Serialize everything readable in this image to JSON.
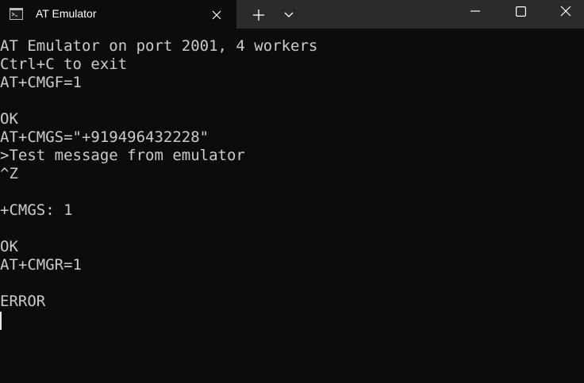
{
  "window": {
    "tab_title": "AT Emulator",
    "tab_icon": "terminal-icon",
    "tab_close_icon": "close-icon",
    "new_tab_icon": "plus-icon",
    "dropdown_icon": "chevron-down-icon",
    "minimize_icon": "minimize-icon",
    "maximize_icon": "maximize-icon",
    "close_icon": "close-icon"
  },
  "colors": {
    "background": "#0c0c0c",
    "titlebar": "#2b2b2b",
    "text": "#cccccc"
  },
  "terminal": {
    "lines": [
      "AT Emulator on port 2001, 4 workers",
      "Ctrl+C to exit",
      "AT+CMGF=1",
      "",
      "OK",
      "AT+CMGS=\"+919496432228\"",
      ">Test message from emulator",
      "^Z",
      "",
      "+CMGS: 1",
      "",
      "OK",
      "AT+CMGR=1",
      "",
      "ERROR",
      ""
    ]
  }
}
